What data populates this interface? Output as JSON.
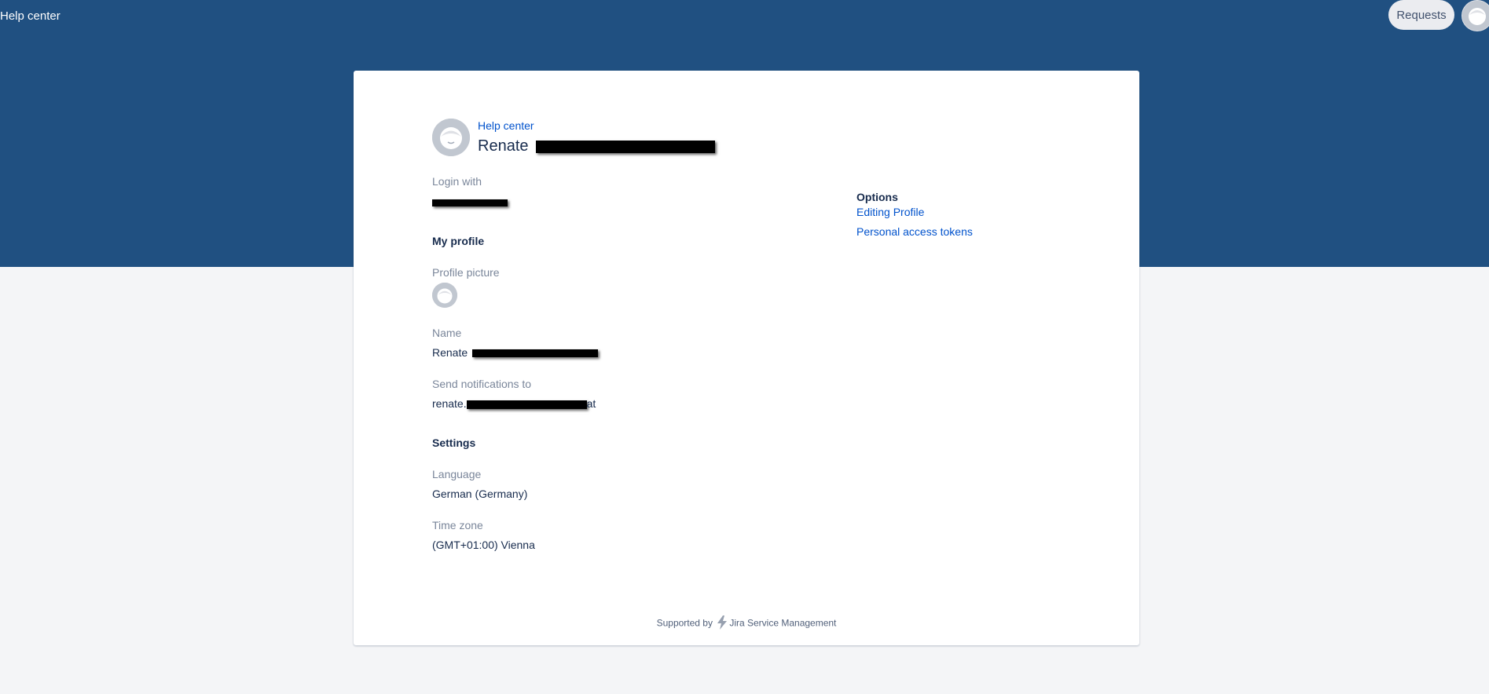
{
  "topbar": {
    "title": "Help center",
    "requests_label": "Requests",
    "avatar_icon": "avatar-icon"
  },
  "profile_header": {
    "breadcrumb": "Help center",
    "first_name": "Renate",
    "avatar_icon": "avatar-icon"
  },
  "login": {
    "label": "Login with"
  },
  "my_profile": {
    "heading": "My profile",
    "picture_label": "Profile picture",
    "name_label": "Name",
    "name_value": "Renate",
    "notify_label": "Send notifications to",
    "notify_prefix": "renate.",
    "notify_suffix": "at"
  },
  "settings": {
    "heading": "Settings",
    "language_label": "Language",
    "language_value": "German (Germany)",
    "timezone_label": "Time zone",
    "timezone_value": "(GMT+01:00) Vienna"
  },
  "options": {
    "heading": "Options",
    "items": [
      {
        "label": "Editing Profile"
      },
      {
        "label": "Personal access tokens"
      }
    ]
  },
  "footer": {
    "prefix": "Supported by",
    "product": "Jira Service Management",
    "logo_icon": "jira-lightning-icon"
  },
  "colors": {
    "banner": "#205081",
    "link": "#0052cc",
    "background": "#f4f5f7"
  }
}
